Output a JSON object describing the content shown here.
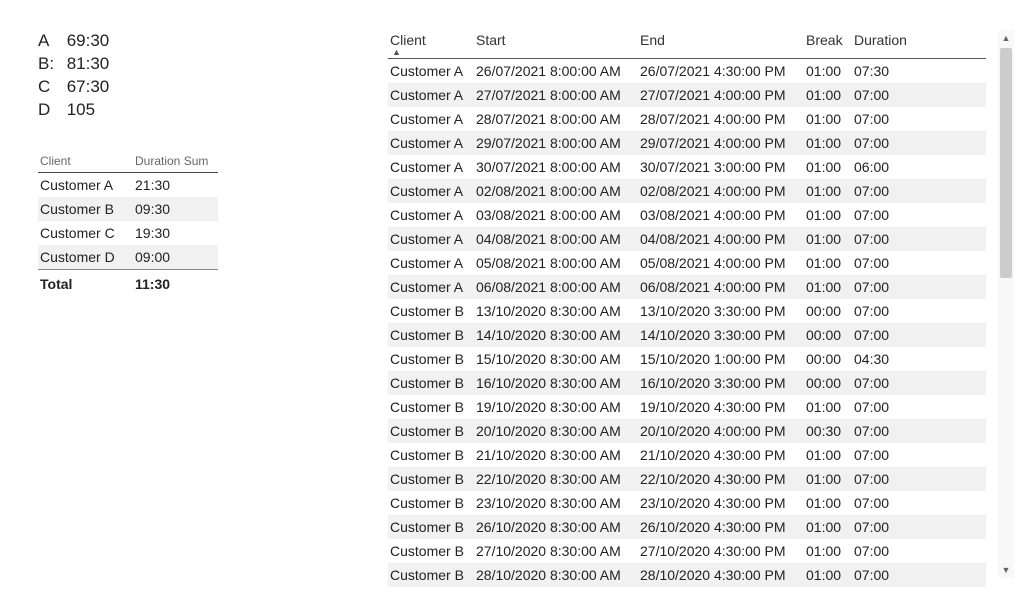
{
  "stats": [
    {
      "label": "A",
      "value": "69:30"
    },
    {
      "label": "B:",
      "value": "81:30"
    },
    {
      "label": "C",
      "value": "67:30"
    },
    {
      "label": "D",
      "value": "105"
    }
  ],
  "summary": {
    "headers": {
      "client": "Client",
      "sum": "Duration Sum"
    },
    "rows": [
      {
        "client": "Customer A",
        "sum": "21:30"
      },
      {
        "client": "Customer B",
        "sum": "09:30"
      },
      {
        "client": "Customer C",
        "sum": "19:30"
      },
      {
        "client": "Customer D",
        "sum": "09:00"
      }
    ],
    "total": {
      "label": "Total",
      "value": "11:30"
    }
  },
  "main": {
    "headers": {
      "client": "Client",
      "start": "Start",
      "end": "End",
      "break": "Break",
      "duration": "Duration"
    },
    "sort_indicator": "▲",
    "rows": [
      {
        "client": "Customer A",
        "start": "26/07/2021 8:00:00 AM",
        "end": "26/07/2021 4:30:00 PM",
        "break": "01:00",
        "duration": "07:30"
      },
      {
        "client": "Customer A",
        "start": "27/07/2021 8:00:00 AM",
        "end": "27/07/2021 4:00:00 PM",
        "break": "01:00",
        "duration": "07:00"
      },
      {
        "client": "Customer A",
        "start": "28/07/2021 8:00:00 AM",
        "end": "28/07/2021 4:00:00 PM",
        "break": "01:00",
        "duration": "07:00"
      },
      {
        "client": "Customer A",
        "start": "29/07/2021 8:00:00 AM",
        "end": "29/07/2021 4:00:00 PM",
        "break": "01:00",
        "duration": "07:00"
      },
      {
        "client": "Customer A",
        "start": "30/07/2021 8:00:00 AM",
        "end": "30/07/2021 3:00:00 PM",
        "break": "01:00",
        "duration": "06:00"
      },
      {
        "client": "Customer A",
        "start": "02/08/2021 8:00:00 AM",
        "end": "02/08/2021 4:00:00 PM",
        "break": "01:00",
        "duration": "07:00"
      },
      {
        "client": "Customer A",
        "start": "03/08/2021 8:00:00 AM",
        "end": "03/08/2021 4:00:00 PM",
        "break": "01:00",
        "duration": "07:00"
      },
      {
        "client": "Customer A",
        "start": "04/08/2021 8:00:00 AM",
        "end": "04/08/2021 4:00:00 PM",
        "break": "01:00",
        "duration": "07:00"
      },
      {
        "client": "Customer A",
        "start": "05/08/2021 8:00:00 AM",
        "end": "05/08/2021 4:00:00 PM",
        "break": "01:00",
        "duration": "07:00"
      },
      {
        "client": "Customer A",
        "start": "06/08/2021 8:00:00 AM",
        "end": "06/08/2021 4:00:00 PM",
        "break": "01:00",
        "duration": "07:00"
      },
      {
        "client": "Customer B",
        "start": "13/10/2020 8:30:00 AM",
        "end": "13/10/2020 3:30:00 PM",
        "break": "00:00",
        "duration": "07:00"
      },
      {
        "client": "Customer B",
        "start": "14/10/2020 8:30:00 AM",
        "end": "14/10/2020 3:30:00 PM",
        "break": "00:00",
        "duration": "07:00"
      },
      {
        "client": "Customer B",
        "start": "15/10/2020 8:30:00 AM",
        "end": "15/10/2020 1:00:00 PM",
        "break": "00:00",
        "duration": "04:30"
      },
      {
        "client": "Customer B",
        "start": "16/10/2020 8:30:00 AM",
        "end": "16/10/2020 3:30:00 PM",
        "break": "00:00",
        "duration": "07:00"
      },
      {
        "client": "Customer B",
        "start": "19/10/2020 8:30:00 AM",
        "end": "19/10/2020 4:30:00 PM",
        "break": "01:00",
        "duration": "07:00"
      },
      {
        "client": "Customer B",
        "start": "20/10/2020 8:30:00 AM",
        "end": "20/10/2020 4:00:00 PM",
        "break": "00:30",
        "duration": "07:00"
      },
      {
        "client": "Customer B",
        "start": "21/10/2020 8:30:00 AM",
        "end": "21/10/2020 4:30:00 PM",
        "break": "01:00",
        "duration": "07:00"
      },
      {
        "client": "Customer B",
        "start": "22/10/2020 8:30:00 AM",
        "end": "22/10/2020 4:30:00 PM",
        "break": "01:00",
        "duration": "07:00"
      },
      {
        "client": "Customer B",
        "start": "23/10/2020 8:30:00 AM",
        "end": "23/10/2020 4:30:00 PM",
        "break": "01:00",
        "duration": "07:00"
      },
      {
        "client": "Customer B",
        "start": "26/10/2020 8:30:00 AM",
        "end": "26/10/2020 4:30:00 PM",
        "break": "01:00",
        "duration": "07:00"
      },
      {
        "client": "Customer B",
        "start": "27/10/2020 8:30:00 AM",
        "end": "27/10/2020 4:30:00 PM",
        "break": "01:00",
        "duration": "07:00"
      },
      {
        "client": "Customer B",
        "start": "28/10/2020 8:30:00 AM",
        "end": "28/10/2020 4:30:00 PM",
        "break": "01:00",
        "duration": "07:00"
      }
    ]
  },
  "scrollbar": {
    "up": "▲",
    "down": "▼"
  }
}
